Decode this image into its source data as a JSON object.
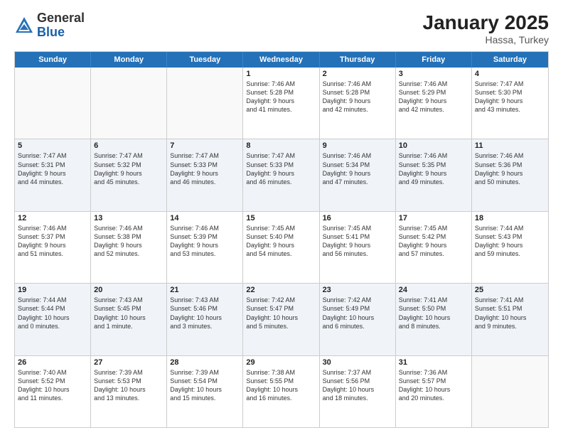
{
  "logo": {
    "general": "General",
    "blue": "Blue"
  },
  "header": {
    "month": "January 2025",
    "location": "Hassa, Turkey"
  },
  "weekdays": [
    "Sunday",
    "Monday",
    "Tuesday",
    "Wednesday",
    "Thursday",
    "Friday",
    "Saturday"
  ],
  "rows": [
    [
      {
        "day": "",
        "info": "",
        "empty": true
      },
      {
        "day": "",
        "info": "",
        "empty": true
      },
      {
        "day": "",
        "info": "",
        "empty": true
      },
      {
        "day": "1",
        "info": "Sunrise: 7:46 AM\nSunset: 5:28 PM\nDaylight: 9 hours\nand 41 minutes."
      },
      {
        "day": "2",
        "info": "Sunrise: 7:46 AM\nSunset: 5:28 PM\nDaylight: 9 hours\nand 42 minutes."
      },
      {
        "day": "3",
        "info": "Sunrise: 7:46 AM\nSunset: 5:29 PM\nDaylight: 9 hours\nand 42 minutes."
      },
      {
        "day": "4",
        "info": "Sunrise: 7:47 AM\nSunset: 5:30 PM\nDaylight: 9 hours\nand 43 minutes."
      }
    ],
    [
      {
        "day": "5",
        "info": "Sunrise: 7:47 AM\nSunset: 5:31 PM\nDaylight: 9 hours\nand 44 minutes."
      },
      {
        "day": "6",
        "info": "Sunrise: 7:47 AM\nSunset: 5:32 PM\nDaylight: 9 hours\nand 45 minutes."
      },
      {
        "day": "7",
        "info": "Sunrise: 7:47 AM\nSunset: 5:33 PM\nDaylight: 9 hours\nand 46 minutes."
      },
      {
        "day": "8",
        "info": "Sunrise: 7:47 AM\nSunset: 5:33 PM\nDaylight: 9 hours\nand 46 minutes."
      },
      {
        "day": "9",
        "info": "Sunrise: 7:46 AM\nSunset: 5:34 PM\nDaylight: 9 hours\nand 47 minutes."
      },
      {
        "day": "10",
        "info": "Sunrise: 7:46 AM\nSunset: 5:35 PM\nDaylight: 9 hours\nand 49 minutes."
      },
      {
        "day": "11",
        "info": "Sunrise: 7:46 AM\nSunset: 5:36 PM\nDaylight: 9 hours\nand 50 minutes."
      }
    ],
    [
      {
        "day": "12",
        "info": "Sunrise: 7:46 AM\nSunset: 5:37 PM\nDaylight: 9 hours\nand 51 minutes."
      },
      {
        "day": "13",
        "info": "Sunrise: 7:46 AM\nSunset: 5:38 PM\nDaylight: 9 hours\nand 52 minutes."
      },
      {
        "day": "14",
        "info": "Sunrise: 7:46 AM\nSunset: 5:39 PM\nDaylight: 9 hours\nand 53 minutes."
      },
      {
        "day": "15",
        "info": "Sunrise: 7:45 AM\nSunset: 5:40 PM\nDaylight: 9 hours\nand 54 minutes."
      },
      {
        "day": "16",
        "info": "Sunrise: 7:45 AM\nSunset: 5:41 PM\nDaylight: 9 hours\nand 56 minutes."
      },
      {
        "day": "17",
        "info": "Sunrise: 7:45 AM\nSunset: 5:42 PM\nDaylight: 9 hours\nand 57 minutes."
      },
      {
        "day": "18",
        "info": "Sunrise: 7:44 AM\nSunset: 5:43 PM\nDaylight: 9 hours\nand 59 minutes."
      }
    ],
    [
      {
        "day": "19",
        "info": "Sunrise: 7:44 AM\nSunset: 5:44 PM\nDaylight: 10 hours\nand 0 minutes."
      },
      {
        "day": "20",
        "info": "Sunrise: 7:43 AM\nSunset: 5:45 PM\nDaylight: 10 hours\nand 1 minute."
      },
      {
        "day": "21",
        "info": "Sunrise: 7:43 AM\nSunset: 5:46 PM\nDaylight: 10 hours\nand 3 minutes."
      },
      {
        "day": "22",
        "info": "Sunrise: 7:42 AM\nSunset: 5:47 PM\nDaylight: 10 hours\nand 5 minutes."
      },
      {
        "day": "23",
        "info": "Sunrise: 7:42 AM\nSunset: 5:49 PM\nDaylight: 10 hours\nand 6 minutes."
      },
      {
        "day": "24",
        "info": "Sunrise: 7:41 AM\nSunset: 5:50 PM\nDaylight: 10 hours\nand 8 minutes."
      },
      {
        "day": "25",
        "info": "Sunrise: 7:41 AM\nSunset: 5:51 PM\nDaylight: 10 hours\nand 9 minutes."
      }
    ],
    [
      {
        "day": "26",
        "info": "Sunrise: 7:40 AM\nSunset: 5:52 PM\nDaylight: 10 hours\nand 11 minutes."
      },
      {
        "day": "27",
        "info": "Sunrise: 7:39 AM\nSunset: 5:53 PM\nDaylight: 10 hours\nand 13 minutes."
      },
      {
        "day": "28",
        "info": "Sunrise: 7:39 AM\nSunset: 5:54 PM\nDaylight: 10 hours\nand 15 minutes."
      },
      {
        "day": "29",
        "info": "Sunrise: 7:38 AM\nSunset: 5:55 PM\nDaylight: 10 hours\nand 16 minutes."
      },
      {
        "day": "30",
        "info": "Sunrise: 7:37 AM\nSunset: 5:56 PM\nDaylight: 10 hours\nand 18 minutes."
      },
      {
        "day": "31",
        "info": "Sunrise: 7:36 AM\nSunset: 5:57 PM\nDaylight: 10 hours\nand 20 minutes."
      },
      {
        "day": "",
        "info": "",
        "empty": true
      }
    ]
  ]
}
